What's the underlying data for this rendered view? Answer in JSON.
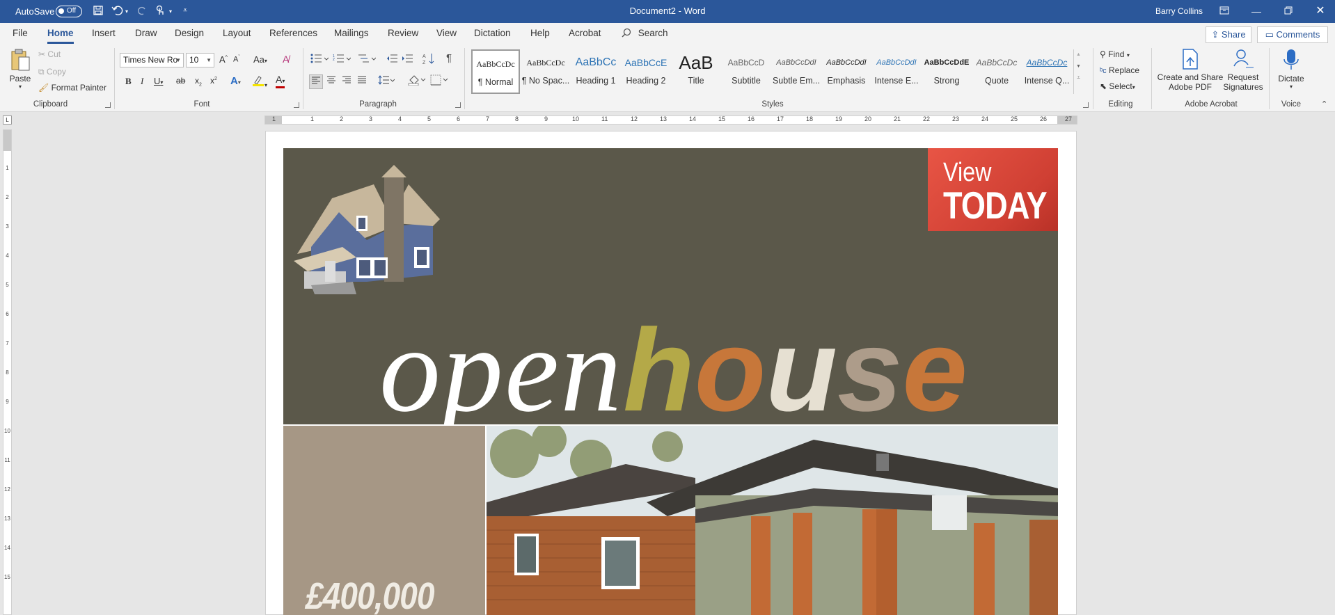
{
  "titlebar": {
    "autosave_label": "AutoSave",
    "autosave_state": "Off",
    "document_title": "Document2 - Word",
    "user_name": "Barry Collins"
  },
  "tabs": [
    "File",
    "Home",
    "Insert",
    "Draw",
    "Design",
    "Layout",
    "References",
    "Mailings",
    "Review",
    "View",
    "Dictation",
    "Help",
    "Acrobat"
  ],
  "active_tab": "Home",
  "search_label": "Search",
  "share_label": "Share",
  "comments_label": "Comments",
  "clipboard": {
    "paste": "Paste",
    "cut": "Cut",
    "copy": "Copy",
    "format_painter": "Format Painter",
    "group": "Clipboard"
  },
  "font": {
    "name": "Times New Ro",
    "size": "10",
    "group": "Font",
    "change_case": "Aa"
  },
  "paragraph": {
    "group": "Paragraph"
  },
  "styles": {
    "group": "Styles",
    "items": [
      {
        "preview": "AaBbCcDc",
        "name": "¶ Normal"
      },
      {
        "preview": "AaBbCcDc",
        "name": "¶ No Spac..."
      },
      {
        "preview": "AaBbCc",
        "name": "Heading 1"
      },
      {
        "preview": "AaBbCcE",
        "name": "Heading 2"
      },
      {
        "preview": "AaB",
        "name": "Title"
      },
      {
        "preview": "AaBbCcD",
        "name": "Subtitle"
      },
      {
        "preview": "AaBbCcDdI",
        "name": "Subtle Em..."
      },
      {
        "preview": "AaBbCcDdI",
        "name": "Emphasis"
      },
      {
        "preview": "AaBbCcDdI",
        "name": "Intense E..."
      },
      {
        "preview": "AaBbCcDdE",
        "name": "Strong"
      },
      {
        "preview": "AaBbCcDc",
        "name": "Quote"
      },
      {
        "preview": "AaBbCcDc",
        "name": "Intense Q..."
      }
    ]
  },
  "editing": {
    "find": "Find",
    "replace": "Replace",
    "select": "Select",
    "group": "Editing"
  },
  "acrobat": {
    "create_share_1": "Create and Share",
    "create_share_2": "Adobe PDF",
    "request_1": "Request",
    "request_2": "Signatures",
    "group": "Adobe Acrobat"
  },
  "voice": {
    "dictate": "Dictate",
    "group": "Voice"
  },
  "ruler": {
    "h_labels": [
      "1",
      "1",
      "2",
      "3",
      "4",
      "5",
      "6",
      "7",
      "8",
      "9",
      "10",
      "11",
      "12",
      "13",
      "14",
      "15",
      "16",
      "17",
      "18",
      "19",
      "20",
      "21",
      "22",
      "23",
      "24",
      "25",
      "26",
      "27"
    ],
    "v_labels": [
      "1",
      "2",
      "3",
      "4",
      "5",
      "6",
      "7",
      "8",
      "9",
      "10",
      "11",
      "12",
      "13",
      "14",
      "15"
    ]
  },
  "flyer": {
    "view": "View",
    "today": "TODAY",
    "word_open": "open",
    "word_h": "h",
    "word_o": "o",
    "word_u": "u",
    "word_s": "s",
    "word_e": "e",
    "price": "£400,000"
  }
}
